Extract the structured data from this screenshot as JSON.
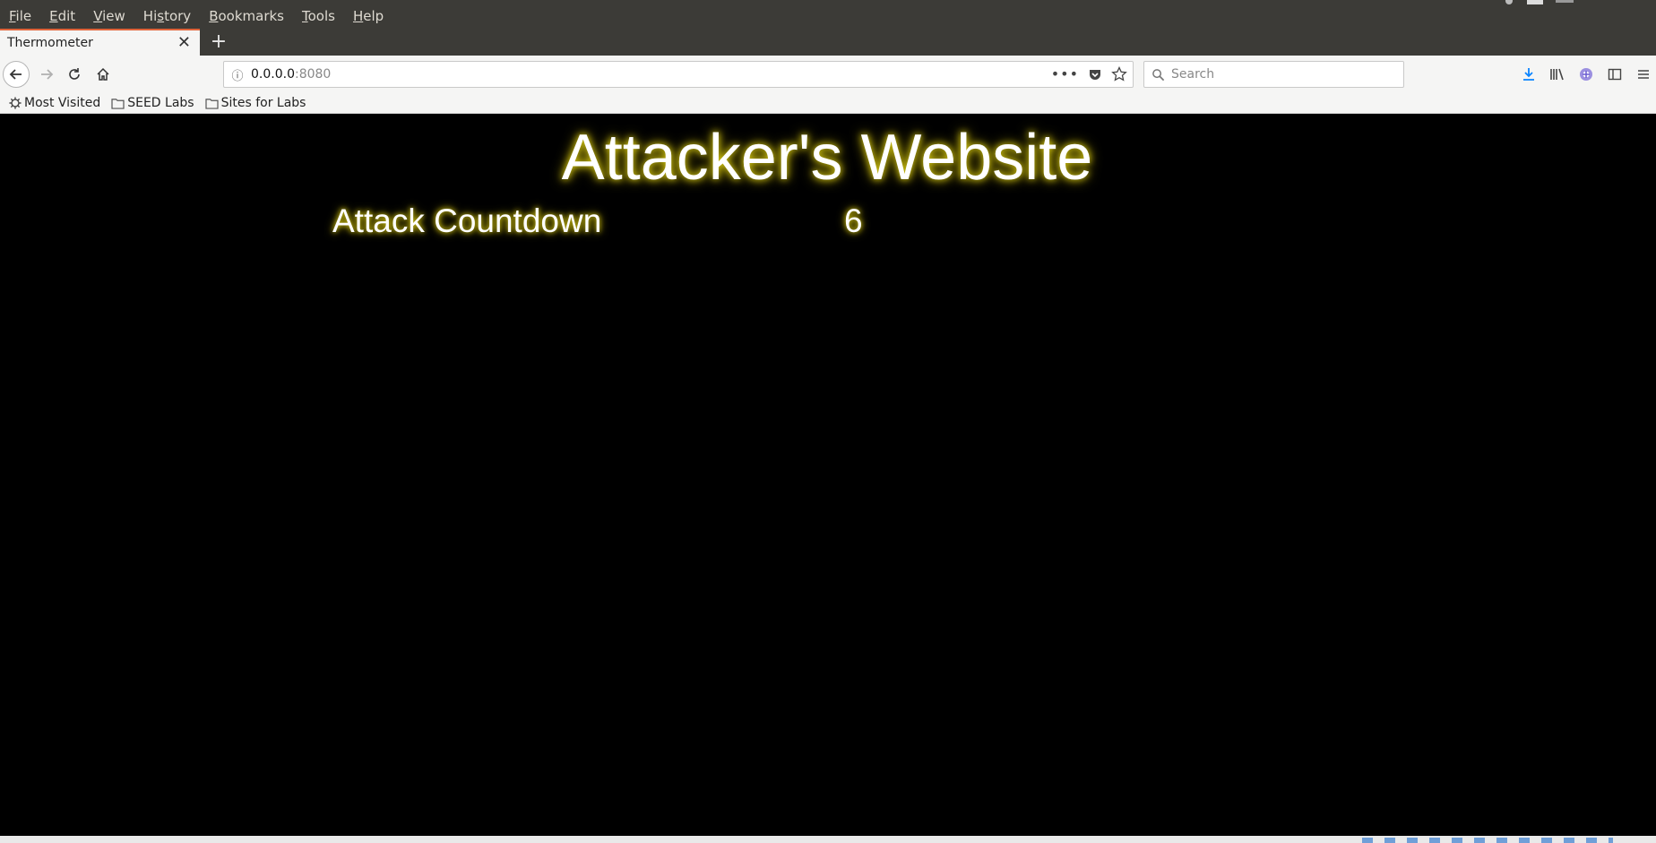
{
  "menubar": {
    "items": [
      {
        "label": "File",
        "underline": "F",
        "rest": "ile"
      },
      {
        "label": "Edit",
        "underline": "E",
        "rest": "dit"
      },
      {
        "label": "View",
        "underline": "V",
        "rest": "iew"
      },
      {
        "label": "History",
        "underline": "s",
        "pre": "Hi",
        "rest": "tory"
      },
      {
        "label": "Bookmarks",
        "underline": "B",
        "rest": "ookmarks"
      },
      {
        "label": "Tools",
        "underline": "T",
        "rest": "ools"
      },
      {
        "label": "Help",
        "underline": "H",
        "rest": "elp"
      }
    ]
  },
  "tab": {
    "title": "Thermometer",
    "close_glyph": "✕",
    "new_tab_glyph": "+"
  },
  "urlbar": {
    "host": "0.0.0.0",
    "port": ":8080"
  },
  "search": {
    "placeholder": "Search"
  },
  "bookmarks": {
    "items": [
      {
        "label": "Most Visited",
        "icon": "gear-icon"
      },
      {
        "label": "SEED Labs",
        "icon": "folder-icon"
      },
      {
        "label": "Sites for Labs",
        "icon": "folder-icon"
      }
    ]
  },
  "page": {
    "title": "Attacker's Website",
    "countdown_label": "Attack Countdown",
    "countdown_value": "6"
  },
  "colors": {
    "glow": "#d9cc14",
    "tab_accent": "#e0643b",
    "menubar_bg": "#3c3b37"
  }
}
